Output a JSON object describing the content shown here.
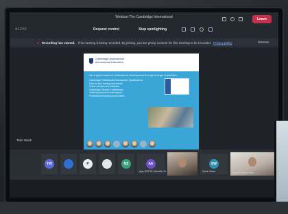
{
  "window": {
    "title": "Webinar-The Cambridge International"
  },
  "toolbar": {
    "left_label": "4:12:52",
    "request_control": "Request control",
    "stop_spotlighting": "Stop spotlighting",
    "leave_label": "Leave"
  },
  "banner": {
    "prefix": "Recording has started.",
    "message": "This meeting is being recorded. By joining, you are giving consent for this meeting to be recorded.",
    "link": "Privacy policy",
    "dismiss": "Dismiss"
  },
  "slide": {
    "logo_line1": "Cambridge Assessment",
    "logo_line2": "International Education",
    "lead": "We support teachers' professional development through a range of activities:",
    "bullets": [
      "Cambridge Professional Development Qualifications",
      "Face-to-face training and events",
      "Online courses and webinars",
      "Cambridge Schools Conferences",
      "Teaching resources and support",
      "Professional learning communities"
    ]
  },
  "presenter_label": "Tahir Wash",
  "participants": [
    {
      "initials": "TW",
      "color": "#5b6bd6",
      "label": ""
    },
    {
      "initials": "",
      "color": "#2f6fd0",
      "label": ""
    },
    {
      "initials": "P",
      "color": "#e9eef5",
      "label": ""
    },
    {
      "initials": "",
      "color": "#e2e7ee",
      "label": ""
    },
    {
      "initials": "NS",
      "color": "#3aa07a",
      "label": ""
    },
    {
      "initials": "AK",
      "color": "#6f4fc7",
      "label": "Ajay SOFTE Scientific Te..."
    },
    {
      "initials": "SW",
      "color": "#2f8fb0",
      "label": "Sarah Wash"
    },
    {
      "initials": "",
      "color": "#2f8fb0",
      "label": "Teresa Sullivan Mic..."
    }
  ]
}
